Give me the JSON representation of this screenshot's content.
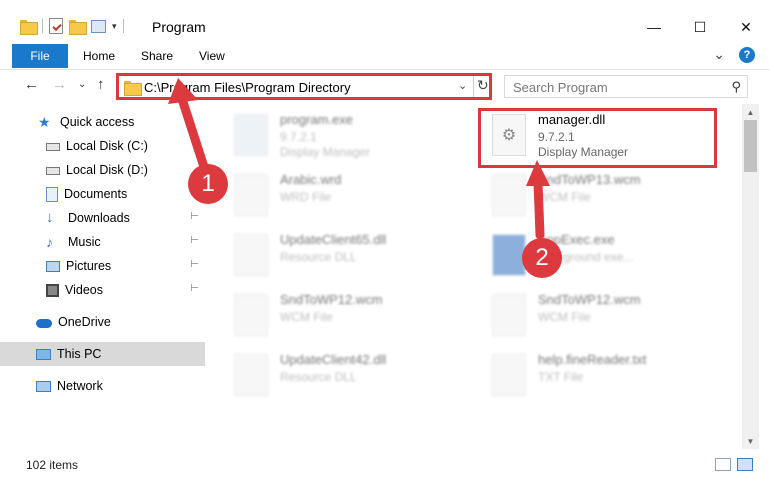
{
  "window": {
    "title": "Program",
    "controls": {
      "minimize": "—",
      "maximize": "☐",
      "close": "✕"
    }
  },
  "ribbon": {
    "tabs": [
      {
        "label": "File",
        "active": true
      },
      {
        "label": "Home"
      },
      {
        "label": "Share"
      },
      {
        "label": "View"
      }
    ],
    "expand_glyph": "⌄",
    "help_glyph": "?"
  },
  "address": {
    "path": "C:\\Program Files\\Program Directory",
    "back_glyph": "←",
    "forward_glyph": "→",
    "recent_glyph": "⌄",
    "up_glyph": "↑",
    "dropdown_glyph": "⌄",
    "refresh_glyph": "↻"
  },
  "search": {
    "placeholder": "Search Program",
    "icon": "search-icon"
  },
  "nav": {
    "items": [
      {
        "label": "Quick access",
        "icon": "star-icon",
        "pinned": false
      },
      {
        "label": "Local Disk (C:)",
        "icon": "drive-icon",
        "pinned": false
      },
      {
        "label": "Local Disk (D:)",
        "icon": "drive-icon",
        "pinned": false
      },
      {
        "label": "Documents",
        "icon": "documents-icon",
        "pinned": true
      },
      {
        "label": "Downloads",
        "icon": "downloads-icon",
        "pinned": true
      },
      {
        "label": "Music",
        "icon": "music-icon",
        "pinned": true
      },
      {
        "label": "Pictures",
        "icon": "pictures-icon",
        "pinned": true
      },
      {
        "label": "Videos",
        "icon": "videos-icon",
        "pinned": true
      },
      {
        "label": "OneDrive",
        "icon": "cloud-icon",
        "pinned": false
      },
      {
        "label": "This PC",
        "icon": "computer-icon",
        "pinned": false,
        "selected": true
      },
      {
        "label": "Network",
        "icon": "network-icon",
        "pinned": false
      }
    ],
    "pin_glyph": "📌"
  },
  "files": [
    {
      "name": "program.exe",
      "line1": "9.7.2.1",
      "line2": "Display Manager",
      "blurred": true
    },
    {
      "name": "manager.dll",
      "line1": "9.7.2.1",
      "line2": "Display Manager",
      "blurred": false,
      "highlighted": true
    },
    {
      "name": "Arabic.wrd",
      "line1": "WRD File",
      "line2": "",
      "blurred": true
    },
    {
      "name": "SndToWP13.wcm",
      "line1": "WCM File",
      "line2": "",
      "blurred": true
    },
    {
      "name": "UpdateClient65.dll",
      "line1": "Resource DLL",
      "line2": "",
      "blurred": true
    },
    {
      "name": "AppExec.exe",
      "line1": "background exe...",
      "line2": "",
      "blurred": true
    },
    {
      "name": "SndToWP12.wcm",
      "line1": "WCM File",
      "line2": "",
      "blurred": true
    },
    {
      "name": "SndToWP12.wcm",
      "line1": "WCM File",
      "line2": "",
      "blurred": true
    },
    {
      "name": "UpdateClient42.dll",
      "line1": "Resource DLL",
      "line2": "",
      "blurred": true
    },
    {
      "name": "help.fineReader.txt",
      "line1": "TXT File",
      "line2": "",
      "blurred": true
    }
  ],
  "status": {
    "item_count": "102 items"
  },
  "annotations": {
    "step1": "1",
    "step2": "2",
    "color": "#dc3a3f"
  }
}
